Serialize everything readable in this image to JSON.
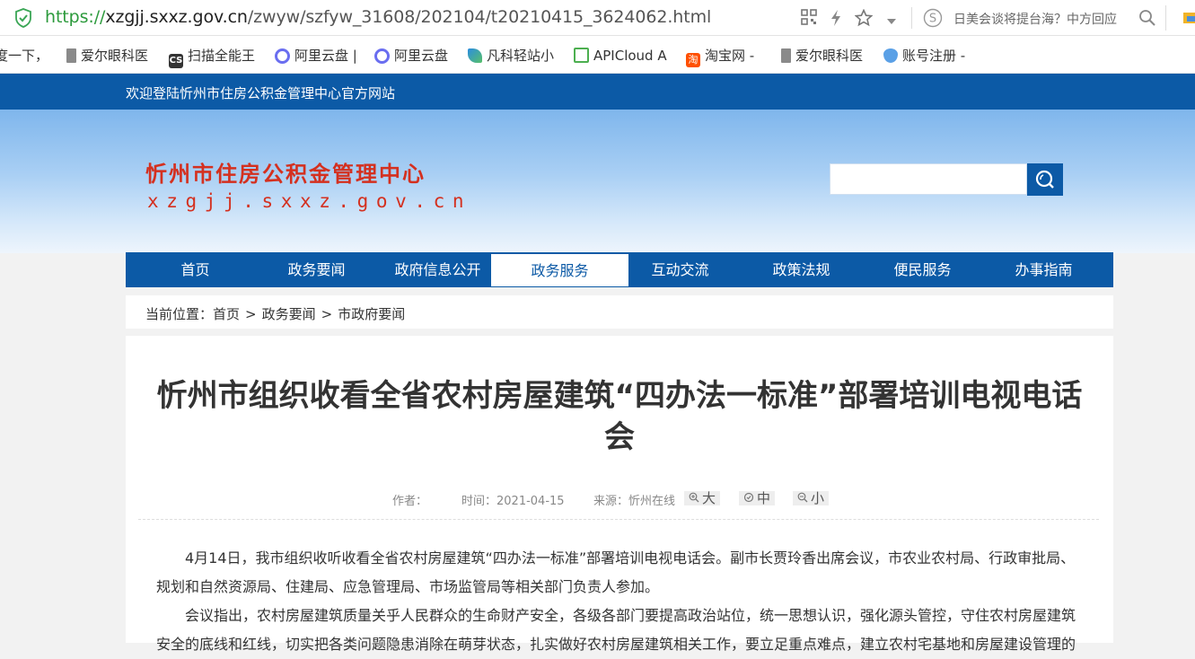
{
  "browser": {
    "url_scheme": "https://",
    "url_host": "xzgjj.sxxz.gov.cn",
    "url_path": "/zwyw/szfyw_31608/202104/t20210415_3624062.html",
    "news_text": "日美会谈将提台海？中方回应",
    "bookmarks": [
      {
        "label": "度一下，",
        "icon": "page-icon",
        "color": "#ffffff"
      },
      {
        "label": "爱尔眼科医",
        "icon": "doc-icon",
        "color": "#888888"
      },
      {
        "label": "扫描全能王",
        "icon": "cs-icon",
        "color": "#333333"
      },
      {
        "label": "阿里云盘 |",
        "icon": "cloud-icon",
        "color": "#6a6ef0"
      },
      {
        "label": "阿里云盘",
        "icon": "cloud-icon",
        "color": "#6a6ef0"
      },
      {
        "label": "凡科轻站小",
        "icon": "leaf-icon",
        "color": "#2b8de0"
      },
      {
        "label": "APICloud A",
        "icon": "apicloud-icon",
        "color": "#4caf50"
      },
      {
        "label": "淘宝网 -",
        "icon": "taobao-icon",
        "color": "#ff5000"
      },
      {
        "label": "爱尔眼科医",
        "icon": "doc-icon",
        "color": "#888888"
      },
      {
        "label": "账号注册 -",
        "icon": "drop-icon",
        "color": "#5aa0e6"
      }
    ]
  },
  "site": {
    "welcome": "欢迎登陆忻州市住房公积金管理中心官方网站",
    "logo_cn": "忻州市住房公积金管理中心",
    "logo_en": "xzgjj.sxxz.gov.cn",
    "search_placeholder": "",
    "nav": [
      {
        "label": "首页",
        "active": false
      },
      {
        "label": "政务要闻",
        "active": false
      },
      {
        "label": "政府信息公开",
        "active": false
      },
      {
        "label": "政务服务",
        "active": true
      },
      {
        "label": "互动交流",
        "active": false
      },
      {
        "label": "政策法规",
        "active": false
      },
      {
        "label": "便民服务",
        "active": false
      },
      {
        "label": "办事指南",
        "active": false
      }
    ],
    "breadcrumb": {
      "prefix": "当前位置：",
      "items": [
        "首页",
        "政务要闻",
        "市政府要闻"
      ],
      "separator": ">"
    },
    "colors": {
      "primary": "#0c5aa6",
      "logo": "#d4301f"
    }
  },
  "article": {
    "title": "忻州市组织收看全省农村房屋建筑“四办法一标准”部署培训电视电话会",
    "author_label": "作者：",
    "time_label": "时间：2021-04-15",
    "source_label": "来源：忻州在线",
    "font_large": "大",
    "font_medium": "中",
    "font_small": "小",
    "paragraphs": [
      "4月14日，我市组织收听收看全省农村房屋建筑“四办法一标准”部署培训电视电话会。副市长贾玲香出席会议，市农业农村局、行政审批局、规划和自然资源局、住建局、应急管理局、市场监管局等相关部门负责人参加。",
      "会议指出，农村房屋建筑质量关乎人民群众的生命财产安全，各级各部门要提高政治站位，统一思想认识，强化源头管控，守住农村房屋建筑安全的底线和红线，切实把各类问题隐患消除在萌芽状态，扎实做好农村房屋建筑相关工作，要立足重点难点，建立农村宅基地和房屋建设管理的"
    ]
  }
}
